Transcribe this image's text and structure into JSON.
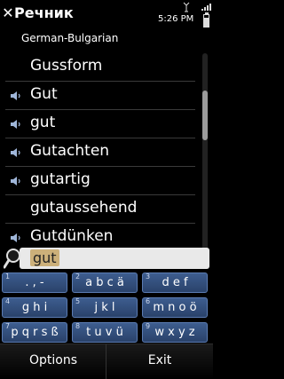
{
  "status": {
    "app_title": "Речник",
    "time": "5:26 PM"
  },
  "subtitle": "German-Bulgarian",
  "list": {
    "items": [
      {
        "word": "Gussform",
        "audio": false
      },
      {
        "word": "Gut",
        "audio": true
      },
      {
        "word": "gut",
        "audio": true
      },
      {
        "word": "Gutachten",
        "audio": true
      },
      {
        "word": "gutartig",
        "audio": true
      },
      {
        "word": "gutaussehend",
        "audio": false
      },
      {
        "word": "Gutdünken",
        "audio": true
      }
    ]
  },
  "search": {
    "value": "gut"
  },
  "keypad": {
    "keys": [
      {
        "num": "1",
        "label": ". , -"
      },
      {
        "num": "2",
        "label": "a b c ä"
      },
      {
        "num": "3",
        "label": "d e f"
      },
      {
        "num": "4",
        "label": "g h i"
      },
      {
        "num": "5",
        "label": "j k l"
      },
      {
        "num": "6",
        "label": "m n o ö"
      },
      {
        "num": "7",
        "label": "p q r s ß"
      },
      {
        "num": "8",
        "label": "t u v ü"
      },
      {
        "num": "9",
        "label": "w x y z"
      }
    ]
  },
  "softkeys": {
    "left": "Options",
    "right": "Exit"
  },
  "colors": {
    "key_bg": "#3d5d8f",
    "highlight": "#ccb07a"
  }
}
